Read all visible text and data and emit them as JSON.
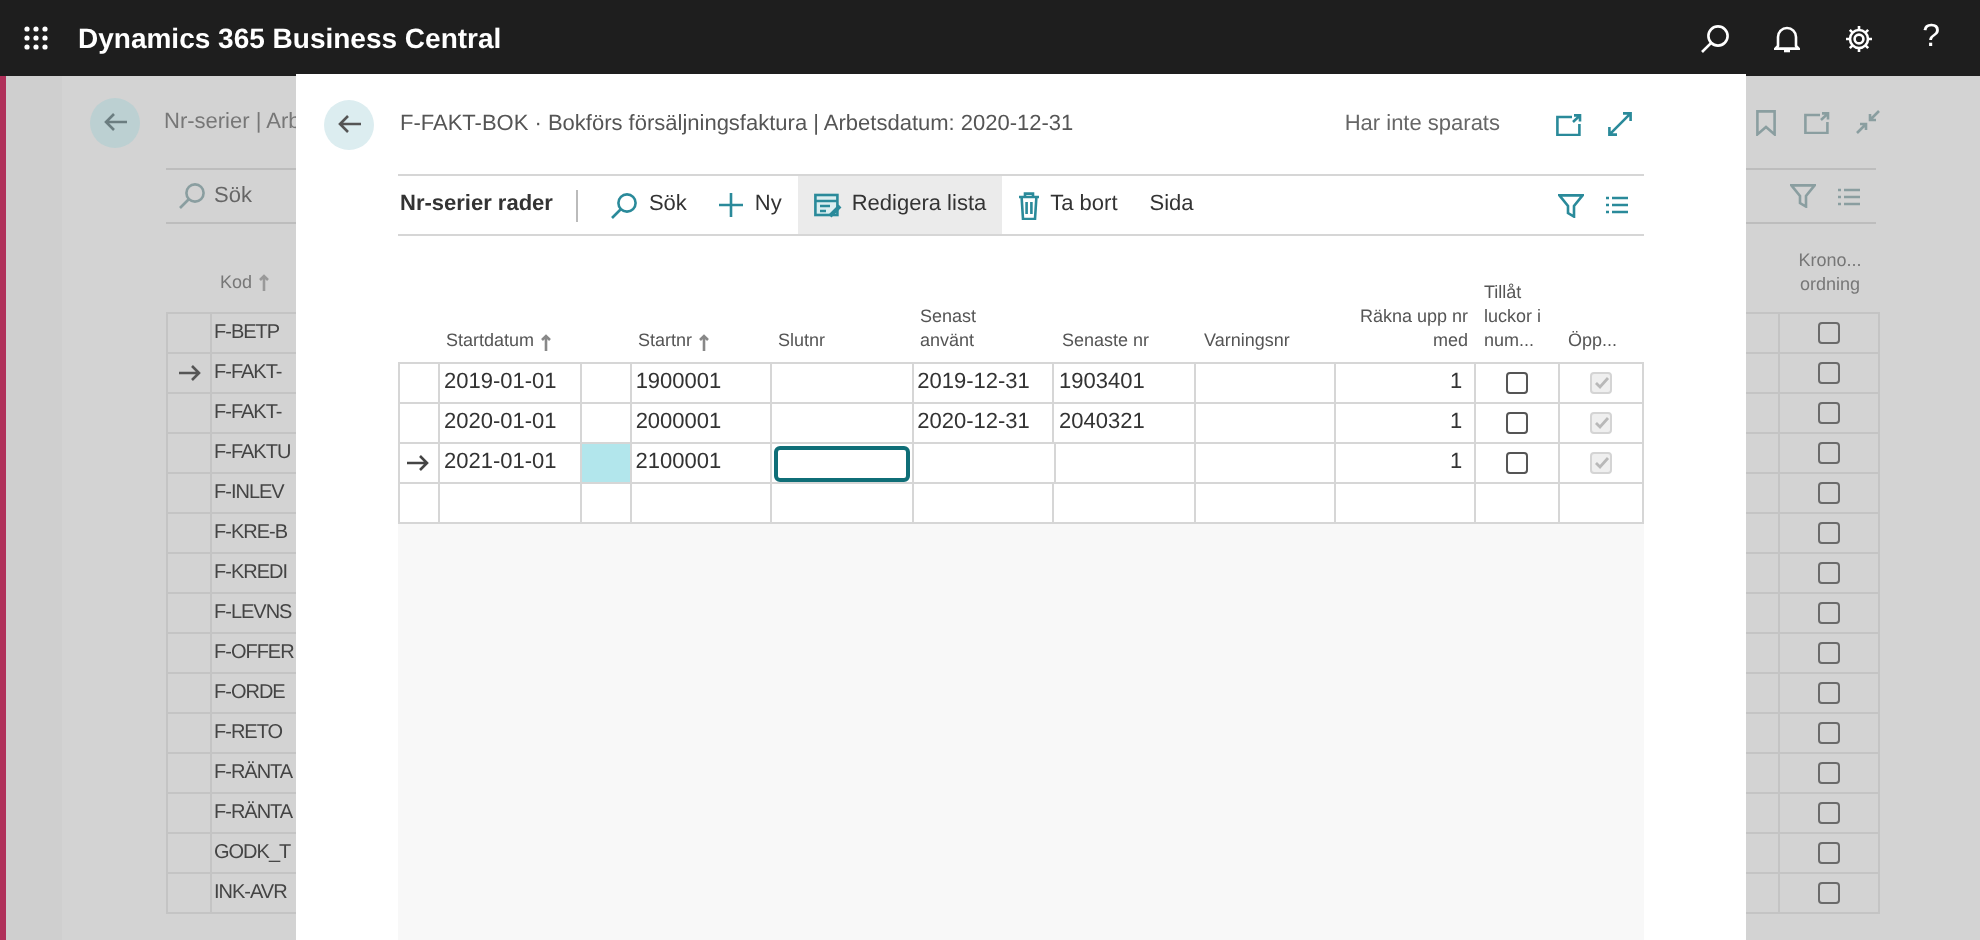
{
  "top_bar": {
    "app_title": "Dynamics 365 Business Central",
    "help": "?"
  },
  "background_page": {
    "title": "Nr-serier | Arb",
    "search": "Sök",
    "code_column": {
      "label": "Kod"
    },
    "flag_column": {
      "label": "Krono... ordning"
    },
    "rows": [
      {
        "code": "F-BETP",
        "current": false,
        "flag": false
      },
      {
        "code": "F-FAKT-",
        "current": true,
        "flag": false
      },
      {
        "code": "F-FAKT-",
        "current": false,
        "flag": false
      },
      {
        "code": "F-FAKTU",
        "current": false,
        "flag": false
      },
      {
        "code": "F-INLEV",
        "current": false,
        "flag": false
      },
      {
        "code": "F-KRE-B",
        "current": false,
        "flag": false
      },
      {
        "code": "F-KREDI",
        "current": false,
        "flag": false
      },
      {
        "code": "F-LEVNS",
        "current": false,
        "flag": false
      },
      {
        "code": "F-OFFER",
        "current": false,
        "flag": false
      },
      {
        "code": "F-ORDE",
        "current": false,
        "flag": false
      },
      {
        "code": "F-RETO",
        "current": false,
        "flag": false
      },
      {
        "code": "F-RÄNTA",
        "current": false,
        "flag": false
      },
      {
        "code": "F-RÄNTA",
        "current": false,
        "flag": false
      },
      {
        "code": "GODK_T",
        "current": false,
        "flag": false
      },
      {
        "code": "INK-AVR",
        "current": false,
        "flag": false
      }
    ]
  },
  "dialog": {
    "title": "F-FAKT-BOK · Bokförs försäljningsfaktura | Arbetsdatum: 2020-12-31",
    "status": "Har inte sparats",
    "toolbar": {
      "label": "Nr-serier rader",
      "actions": [
        {
          "label": "Sök",
          "selected": false
        },
        {
          "label": "Ny",
          "selected": false
        },
        {
          "label": "Redigera lista",
          "selected": true
        },
        {
          "label": "Ta bort",
          "selected": false
        },
        {
          "label": "Sida",
          "selected": false
        }
      ]
    },
    "columns": [
      {
        "label": "Startdatum"
      },
      {
        "label": "Startnr"
      },
      {
        "label": "Slutnr"
      },
      {
        "label": "Senast använt"
      },
      {
        "label": "Senaste nr"
      },
      {
        "label": "Varningsnr"
      },
      {
        "label": "Räkna upp nr med"
      },
      {
        "label": "Tillåt luckor i num..."
      },
      {
        "label": "Öpp..."
      }
    ],
    "rows": [
      {
        "current": false,
        "highlighted": false,
        "editing_end": false,
        "start_date": "2019-01-01",
        "start_no": "1900001",
        "last_used": "2019-12-31",
        "last_no": "1903401",
        "increment": "1",
        "allow_gaps": false,
        "open": true,
        "open_disabled": true
      },
      {
        "current": false,
        "highlighted": false,
        "editing_end": false,
        "start_date": "2020-01-01",
        "start_no": "2000001",
        "last_used": "2020-12-31",
        "last_no": "2040321",
        "increment": "1",
        "allow_gaps": false,
        "open": true,
        "open_disabled": true
      },
      {
        "current": true,
        "highlighted": true,
        "editing_end": true,
        "start_date": "2021-01-01",
        "start_no": "2100001",
        "increment": "1",
        "allow_gaps": false,
        "open": true,
        "open_disabled": true
      }
    ]
  }
}
